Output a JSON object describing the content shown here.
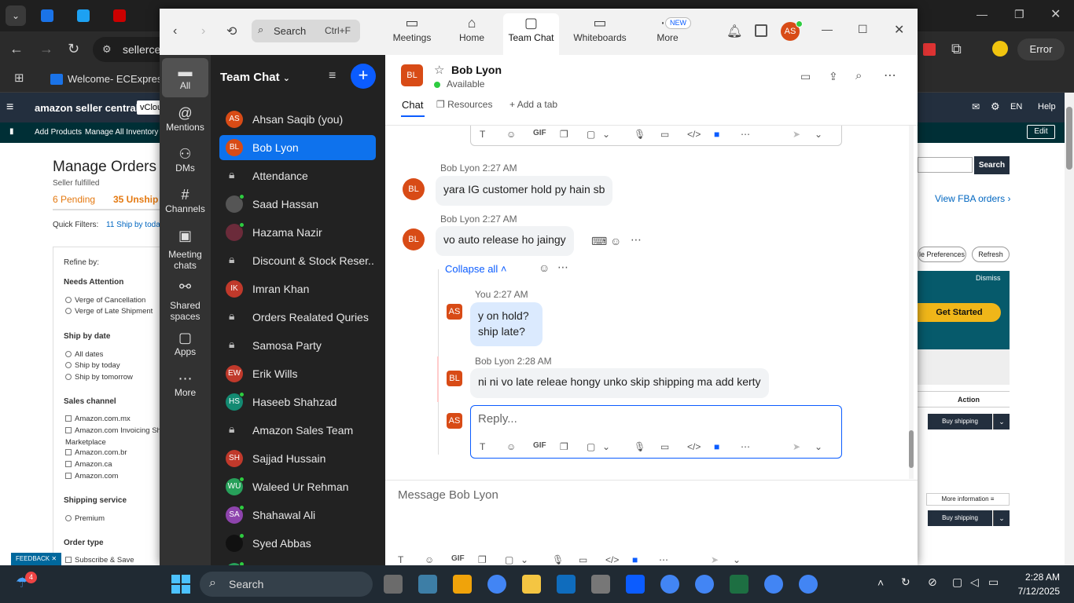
{
  "browser": {
    "url": "sellerce",
    "bookmark_tab": "Welcome- ECExpres...",
    "error_label": "Error"
  },
  "amazon": {
    "brand": "amazon seller central",
    "tenant": "vClou",
    "lang": "EN",
    "help": "Help",
    "nav": [
      "Add Products",
      "Manage All Inventory"
    ],
    "edit": "Edit",
    "title": "Manage Orders",
    "sub": "Seller fulfilled",
    "pending": "6 Pending",
    "unshipped": "35 Unship",
    "quick_filters": "Quick Filters:",
    "ship_today_filter": "11 Ship by today",
    "refine": "Refine by:",
    "needs_attention": "Needs Attention",
    "attention_opts": [
      "Verge of Cancellation",
      "Verge of Late Shipment"
    ],
    "ship_by_date": "Ship by date",
    "date_opts": [
      "All dates",
      "Ship by today",
      "Ship by tomorrow"
    ],
    "sales_channel": "Sales channel",
    "channel_opts": [
      "Amazon.com.mx",
      "Amazon.com Invoicing Sh",
      "Marketplace",
      "Amazon.com.br",
      "Amazon.ca",
      "Amazon.com"
    ],
    "shipping_service": "Shipping service",
    "premium": "Premium",
    "order_type": "Order type",
    "subscribe": "Subscribe & Save",
    "search_btn": "Search",
    "fba_link": "View FBA orders",
    "prefs": "le Preferences",
    "refresh": "Refresh",
    "dismiss": "Dismiss",
    "get_started": "Get Started",
    "action": "Action",
    "buy_shipping": "Buy shipping",
    "more_info": "More information",
    "feedback": "FEEDBACK"
  },
  "zoom": {
    "search": "Search",
    "search_shortcut": "Ctrl+F",
    "nav": [
      {
        "label": "Meetings",
        "icon": "video-icon"
      },
      {
        "label": "Home",
        "icon": "home-icon"
      },
      {
        "label": "Team Chat",
        "icon": "chat-icon"
      },
      {
        "label": "Whiteboards",
        "icon": "whiteboard-icon"
      },
      {
        "label": "More",
        "icon": "more-icon"
      }
    ],
    "new_badge": "NEW",
    "user_initials": "AS",
    "rail": [
      {
        "label": "All",
        "icon": "chat-bubble-icon"
      },
      {
        "label": "Mentions",
        "icon": "at-icon"
      },
      {
        "label": "DMs",
        "icon": "people-icon"
      },
      {
        "label": "Channels",
        "icon": "hash-icon"
      },
      {
        "label": "Meeting chats",
        "icon": "calendar-icon"
      },
      {
        "label": "Shared spaces",
        "icon": "share-icon"
      },
      {
        "label": "Apps",
        "icon": "apps-icon"
      },
      {
        "label": "More",
        "icon": "ellipsis-icon"
      }
    ],
    "list_title": "Team Chat",
    "chats": [
      {
        "name": "Ahsan Saqib (you)",
        "initials": "AS",
        "color": "#d84b16",
        "type": "avatar",
        "online": false
      },
      {
        "name": "Bob Lyon",
        "initials": "BL",
        "color": "#d84b16",
        "type": "avatar",
        "online": false,
        "active": true
      },
      {
        "name": "Attendance",
        "type": "lock"
      },
      {
        "name": "Saad Hassan",
        "initials": "",
        "color": "#555",
        "type": "photo",
        "online": true
      },
      {
        "name": "Hazama Nazir",
        "initials": "",
        "color": "#6b2b3a",
        "type": "photo",
        "online": true
      },
      {
        "name": "Discount & Stock Reser...",
        "type": "lock"
      },
      {
        "name": "Imran Khan",
        "initials": "IK",
        "color": "#c0392b",
        "type": "avatar",
        "online": false
      },
      {
        "name": "Orders Realated Quries",
        "type": "lock"
      },
      {
        "name": "Samosa Party",
        "type": "lock"
      },
      {
        "name": "Erik Wills",
        "initials": "EW",
        "color": "#c0392b",
        "type": "avatar",
        "online": false
      },
      {
        "name": "Haseeb Shahzad",
        "initials": "HS",
        "color": "#138a72",
        "type": "avatar",
        "online": true
      },
      {
        "name": "Amazon Sales Team",
        "type": "lock"
      },
      {
        "name": "Sajjad Hussain",
        "initials": "SH",
        "color": "#c0392b",
        "type": "avatar",
        "online": false
      },
      {
        "name": "Waleed Ur Rehman",
        "initials": "WU",
        "color": "#27a05a",
        "type": "avatar",
        "online": true
      },
      {
        "name": "Shahawal Ali",
        "initials": "SA",
        "color": "#8e44ad",
        "type": "avatar",
        "online": true
      },
      {
        "name": "Syed Abbas",
        "initials": "",
        "color": "#111",
        "type": "photo",
        "online": true
      },
      {
        "name": "Waleed Ayub",
        "initials": "WA",
        "color": "#27a05a",
        "type": "avatar",
        "online": true
      }
    ],
    "header": {
      "initials": "BL",
      "name": "Bob Lyon",
      "status": "Available",
      "tabs": [
        "Chat",
        "Resources",
        "Add a tab"
      ]
    },
    "messages": {
      "m1_meta": "Bob Lyon 2:27 AM",
      "m1_text": "yara IG customer hold py hain sb",
      "m2_meta": "Bob Lyon 2:27 AM",
      "m2_text": "vo auto release ho jaingy",
      "collapse": "Collapse all",
      "r1_meta": "You 2:27 AM",
      "r1_line1": "y on hold?",
      "r1_line2": "ship late?",
      "r2_meta": "Bob Lyon 2:28 AM",
      "r2_text": "ni ni vo late releae hongy unko skip shipping ma add kerty",
      "reply_placeholder": "Reply...",
      "compose_placeholder": "Message Bob Lyon"
    },
    "gif": "GIF"
  },
  "taskbar": {
    "search": "Search",
    "time": "2:28 AM",
    "date": "7/12/2025",
    "badge": "4"
  }
}
